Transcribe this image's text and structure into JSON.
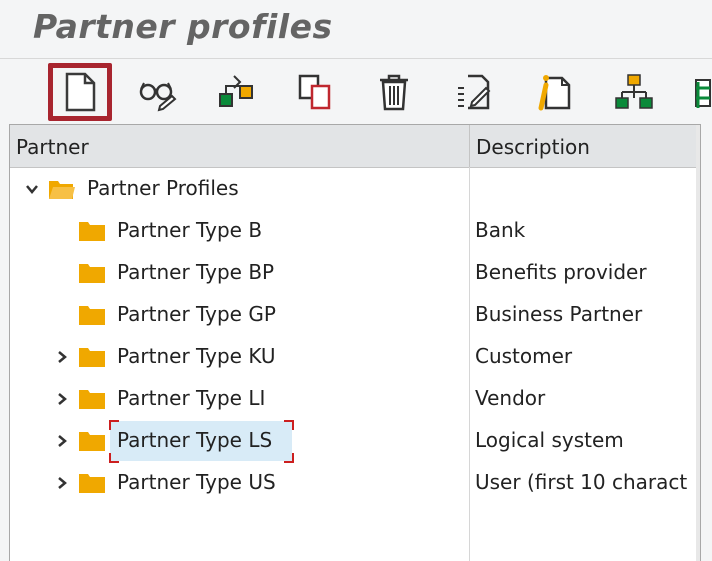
{
  "app": {
    "title": "Partner profiles"
  },
  "toolbar": {
    "buttons": [
      {
        "icon": "new-document-icon"
      },
      {
        "icon": "display-glasses-icon"
      },
      {
        "icon": "change-hierarchy-icon"
      },
      {
        "icon": "copy-icon"
      },
      {
        "icon": "delete-trash-icon"
      },
      {
        "icon": "edit-list-icon"
      },
      {
        "icon": "info-document-icon"
      },
      {
        "icon": "structure-tree-icon"
      },
      {
        "icon": "transfer-arrow-icon"
      }
    ]
  },
  "tree": {
    "columns": {
      "partner": "Partner",
      "description": "Description"
    },
    "root": {
      "label": "Partner Profiles",
      "expanded": true
    },
    "items": [
      {
        "label": "Partner Type B",
        "description": "Bank",
        "expandable": false
      },
      {
        "label": "Partner Type BP",
        "description": "Benefits provider",
        "expandable": false
      },
      {
        "label": "Partner Type GP",
        "description": "Business Partner",
        "expandable": false
      },
      {
        "label": "Partner Type KU",
        "description": "Customer",
        "expandable": true
      },
      {
        "label": "Partner Type LI",
        "description": "Vendor",
        "expandable": true
      },
      {
        "label": "Partner Type LS",
        "description": "Logical system",
        "expandable": true,
        "selected": true
      },
      {
        "label": "Partner Type US",
        "description": "User (first 10 charact",
        "expandable": true
      }
    ]
  },
  "colors": {
    "folder": "#f0a800",
    "selection": "#d8ebf7",
    "focus_corner": "#cc1f1f",
    "highlight_border": "#a8252f"
  }
}
